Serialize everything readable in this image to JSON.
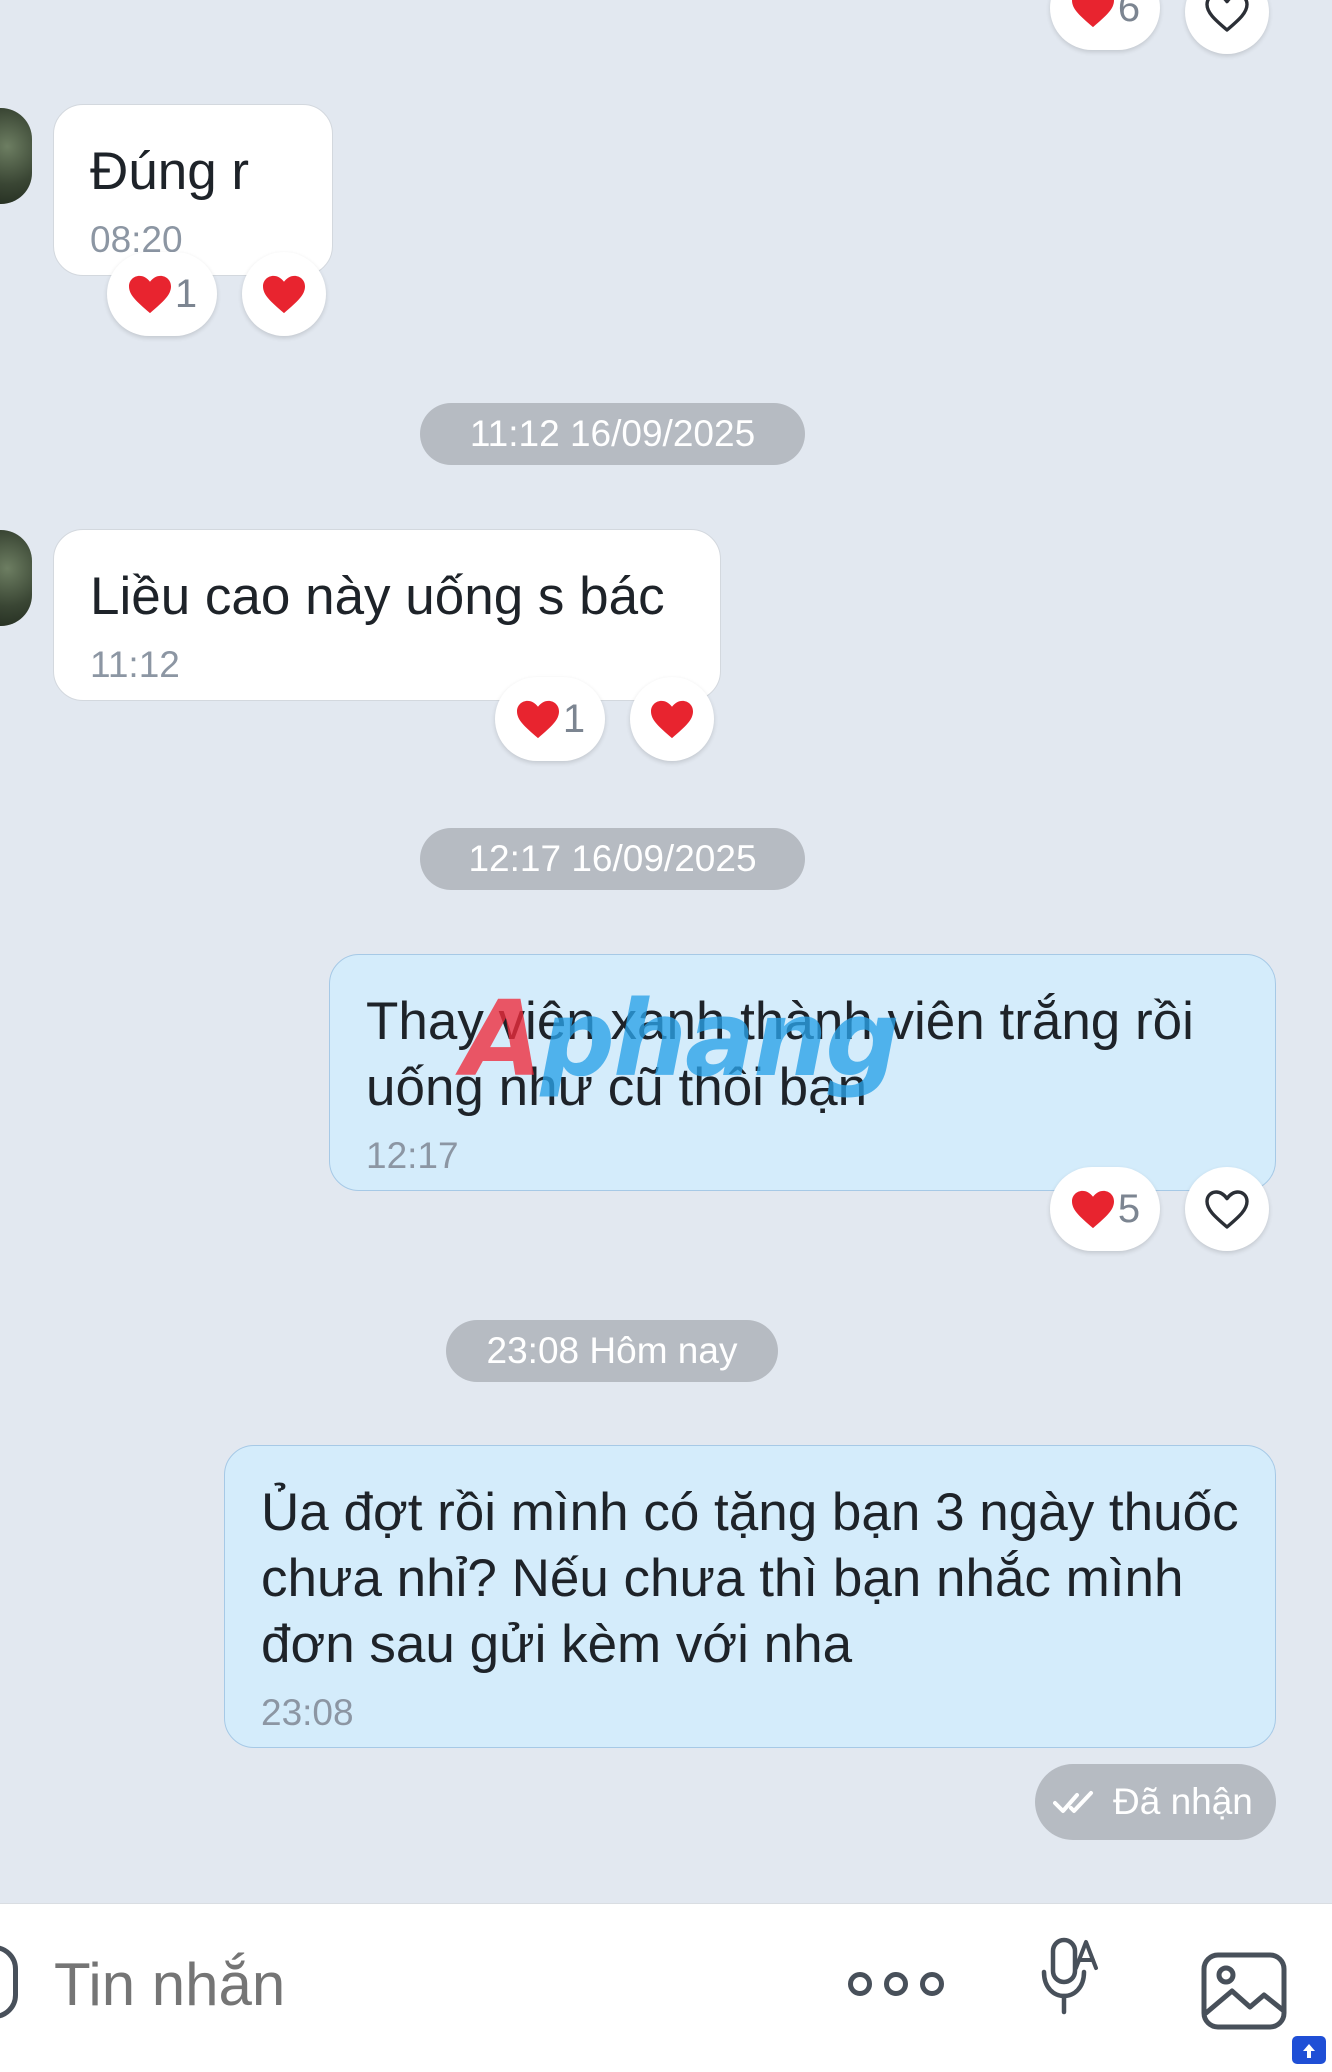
{
  "colors": {
    "background": "#e2e8f0",
    "incoming_bubble": "#ffffff",
    "outgoing_bubble": "#d4ecfb",
    "date_pill": "#b6bbc2",
    "heart": "#e8242f",
    "watermark_red": "#ef2b3b",
    "watermark_blue": "#2aa2e8"
  },
  "top_reactions": {
    "heart_count": "6",
    "heart_icon": "heart-outline-icon"
  },
  "messages": [
    {
      "direction": "incoming",
      "text": "Đúng r",
      "time": "08:20",
      "reaction_count": "1",
      "my_reaction": "heart-filled"
    },
    {
      "direction": "incoming",
      "text": "Liều cao này uống s bác",
      "time": "11:12",
      "reaction_count": "1",
      "my_reaction": "heart-filled"
    },
    {
      "direction": "outgoing",
      "text": "Thay viên xanh thành viên trắng rồi uống như cũ thôi bạn",
      "time": "12:17",
      "reaction_count": "5",
      "my_reaction": "heart-outline"
    },
    {
      "direction": "outgoing",
      "text": "Ủa đợt rồi mình có tặng bạn 3 ngày thuốc chưa nhỉ? Nếu chưa thì bạn nhắc mình đơn sau gửi kèm với nha",
      "time": "23:08"
    }
  ],
  "date_separators": [
    "11:12 16/09/2025",
    "12:17 16/09/2025",
    "23:08 Hôm nay"
  ],
  "status": {
    "label": "Đã nhận",
    "icon": "double-check-icon"
  },
  "watermark": {
    "part1": "A",
    "part2": "phang"
  },
  "input": {
    "placeholder": "Tin nhắn",
    "icons": [
      "sticker-icon",
      "more-icon",
      "voice-to-text-icon",
      "image-icon"
    ]
  }
}
